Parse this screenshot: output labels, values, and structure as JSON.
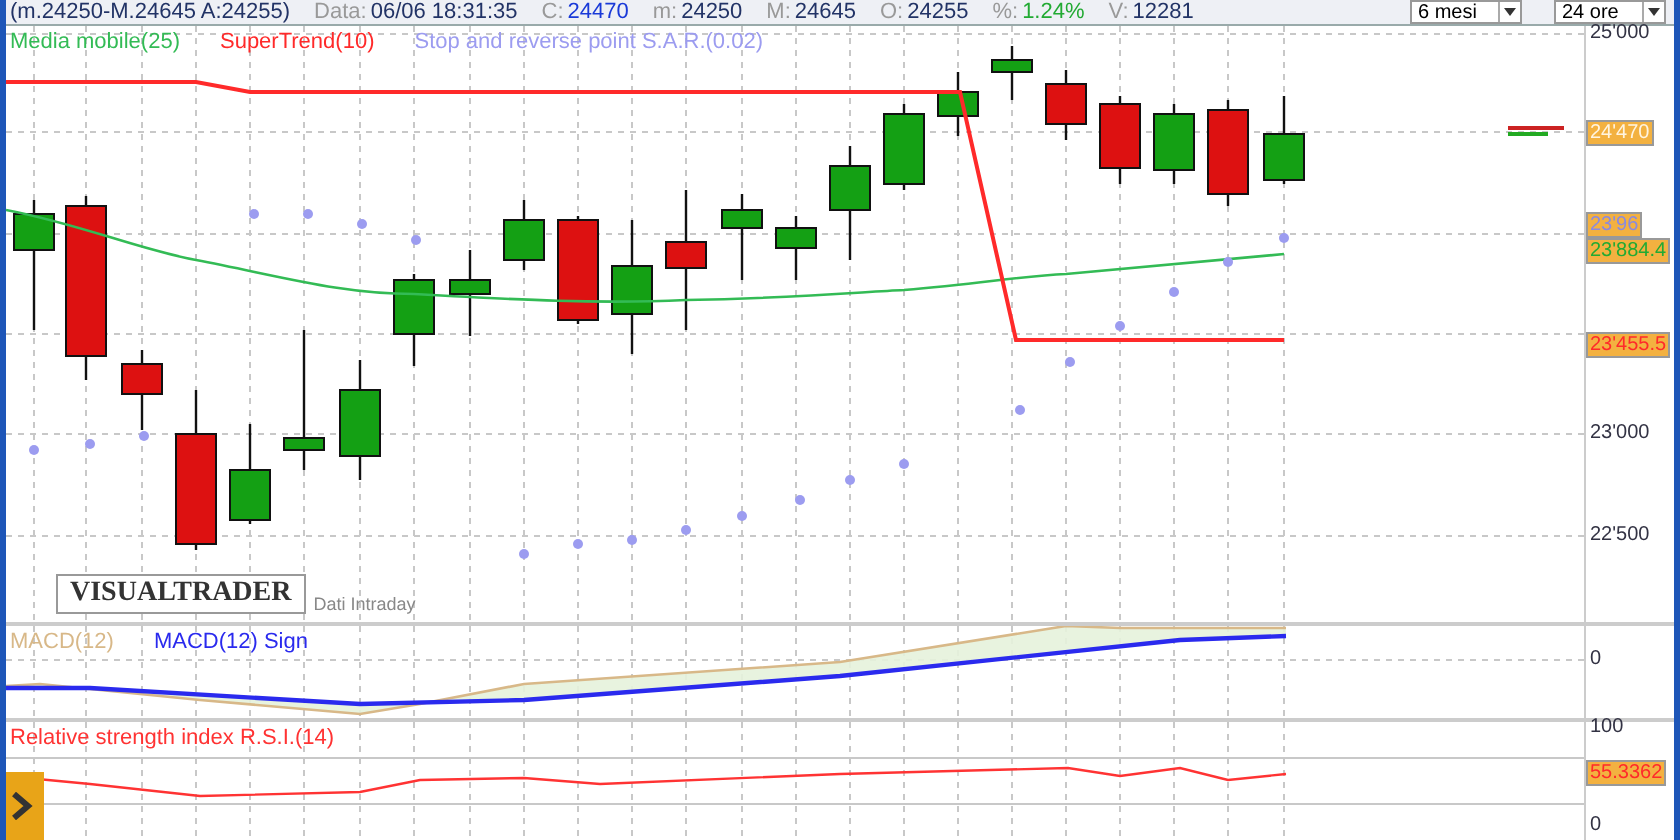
{
  "header": {
    "range": "(m.24250-M.24645 A:24255)",
    "fields": [
      {
        "label": "Data:",
        "value": "06/06 18:31:35",
        "kind": "plain"
      },
      {
        "label": "C:",
        "value": "24470",
        "kind": "close"
      },
      {
        "label": "m:",
        "value": "24250",
        "kind": "plain"
      },
      {
        "label": "M:",
        "value": "24645",
        "kind": "plain"
      },
      {
        "label": "O:",
        "value": "24255",
        "kind": "plain"
      },
      {
        "label": "%:",
        "value": "1.24%",
        "kind": "change"
      },
      {
        "label": "V:",
        "value": "12281",
        "kind": "plain"
      }
    ],
    "selects": [
      {
        "value": "6 mesi"
      },
      {
        "value": "24 ore"
      }
    ]
  },
  "price_panel": {
    "legend": [
      {
        "label": "Media mobile(25)",
        "color": "#33bb55"
      },
      {
        "label": "SuperTrend(10)",
        "color": "#ff2a2a"
      },
      {
        "label": "Stop and reverse point S.A.R.(0.02)",
        "color": "#9c9cf0"
      }
    ],
    "axis_labels": [
      "25'000",
      "23'000",
      "22'500"
    ],
    "value_tags": [
      {
        "value": "24'470",
        "kind": "last"
      },
      {
        "value": "23'96",
        "kind": "sar"
      },
      {
        "value": "23'884.4",
        "kind": "average"
      },
      {
        "value": "23'455.5",
        "kind": "supertrend"
      }
    ],
    "logo": "VISUALTRADER",
    "source": "Dati Intraday"
  },
  "macd_panel": {
    "legend": [
      {
        "label": "MACD(12)",
        "color": "#d8b888"
      },
      {
        "label": "MACD(12) Sign",
        "color": "#2a2aee"
      }
    ],
    "axis_labels": [
      "0"
    ]
  },
  "rsi_panel": {
    "legend": [
      {
        "label": "Relative strength index R.S.I.(14)",
        "color": "#ff3333"
      }
    ],
    "axis_labels": [
      "100",
      "0"
    ],
    "value_tag": {
      "value": "55.3362",
      "kind": "rsi"
    }
  }
}
